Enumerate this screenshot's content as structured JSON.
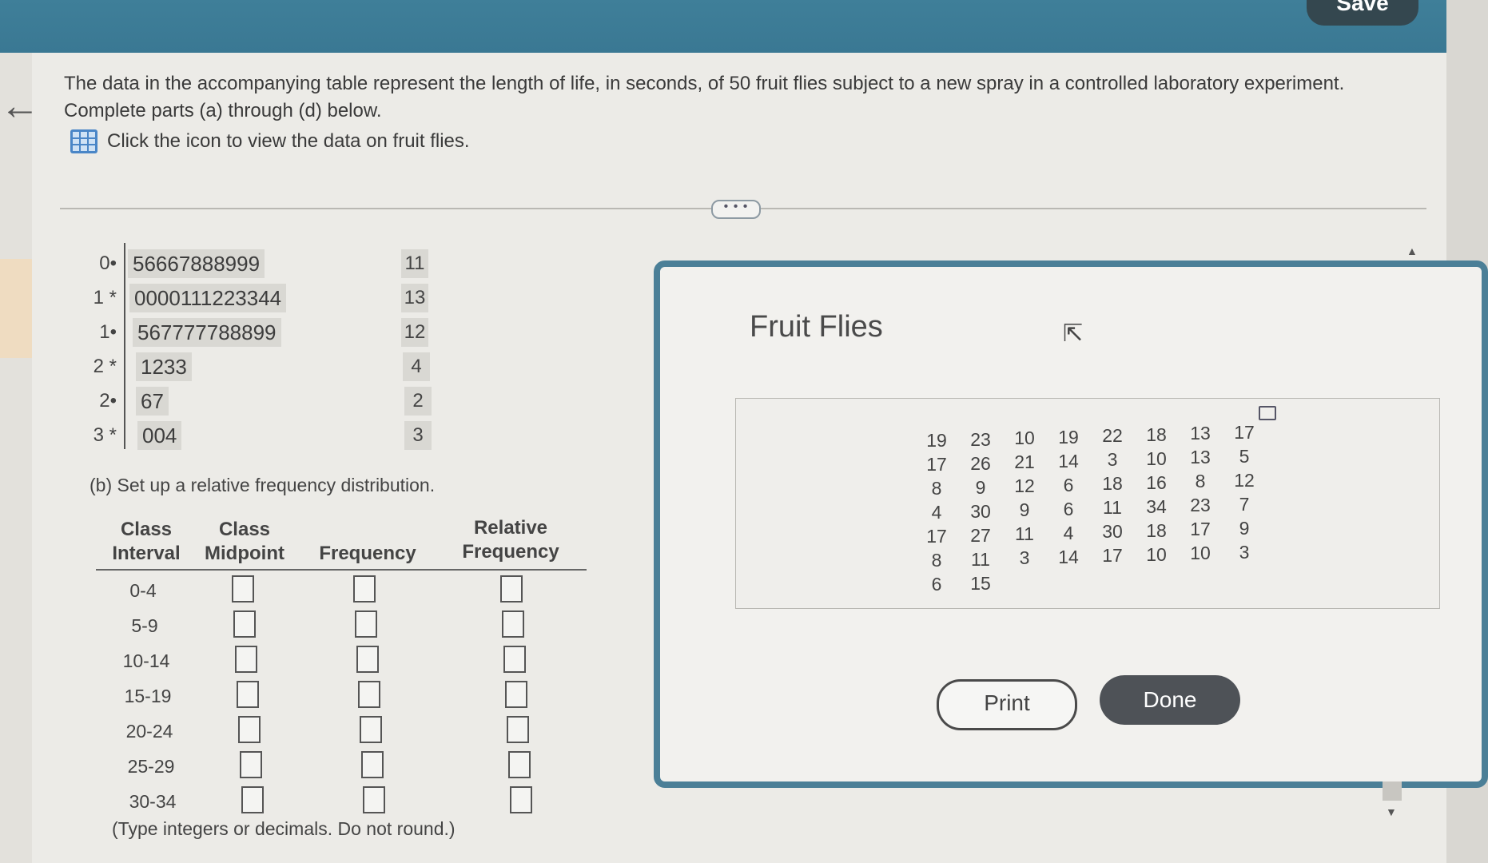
{
  "header": {
    "save_label": "Save"
  },
  "question": {
    "prompt": "The data in the accompanying table represent the length of life, in seconds, of 50 fruit flies subject to a new spray in a controlled laboratory experiment. Complete parts (a) through (d) below.",
    "data_link": "Click the icon to view the data on fruit flies.",
    "expand_label": "• • •"
  },
  "stem_leaf": {
    "rows": [
      {
        "stem": "0•",
        "leaves": "56667888999",
        "count": "11"
      },
      {
        "stem": "1 *",
        "leaves": "0000111223344",
        "count": "13"
      },
      {
        "stem": "1•",
        "leaves": "567777788899",
        "count": "12"
      },
      {
        "stem": "2 *",
        "leaves": "1233",
        "count": "4"
      },
      {
        "stem": "2•",
        "leaves": "67",
        "count": "2"
      },
      {
        "stem": "3 *",
        "leaves": "004",
        "count": "3"
      }
    ]
  },
  "part_b": {
    "instruction": "(b) Set up a relative frequency distribution.",
    "headers": {
      "class_interval": "Class Interval",
      "class_midpoint": "Class Midpoint",
      "frequency": "Frequency",
      "relative_frequency": "Relative Frequency"
    },
    "intervals": [
      "0-4",
      "5-9",
      "10-14",
      "15-19",
      "20-24",
      "25-29",
      "30-34"
    ],
    "footnote": "(Type integers or decimals. Do not round.)"
  },
  "popup": {
    "title": "Fruit Flies",
    "columns": [
      [
        "19",
        "17",
        "8",
        "4",
        "17",
        "8",
        "6"
      ],
      [
        "23",
        "26",
        "9",
        "30",
        "27",
        "11",
        "15"
      ],
      [
        "10",
        "21",
        "12",
        "9",
        "11",
        "3"
      ],
      [
        "19",
        "14",
        "6",
        "6",
        "4",
        "14"
      ],
      [
        "22",
        "3",
        "18",
        "11",
        "30",
        "17"
      ],
      [
        "18",
        "10",
        "16",
        "34",
        "18",
        "10"
      ],
      [
        "13",
        "13",
        "8",
        "23",
        "17",
        "10"
      ],
      [
        "17",
        "5",
        "12",
        "7",
        "9",
        "3"
      ]
    ],
    "print_label": "Print",
    "done_label": "Done"
  }
}
